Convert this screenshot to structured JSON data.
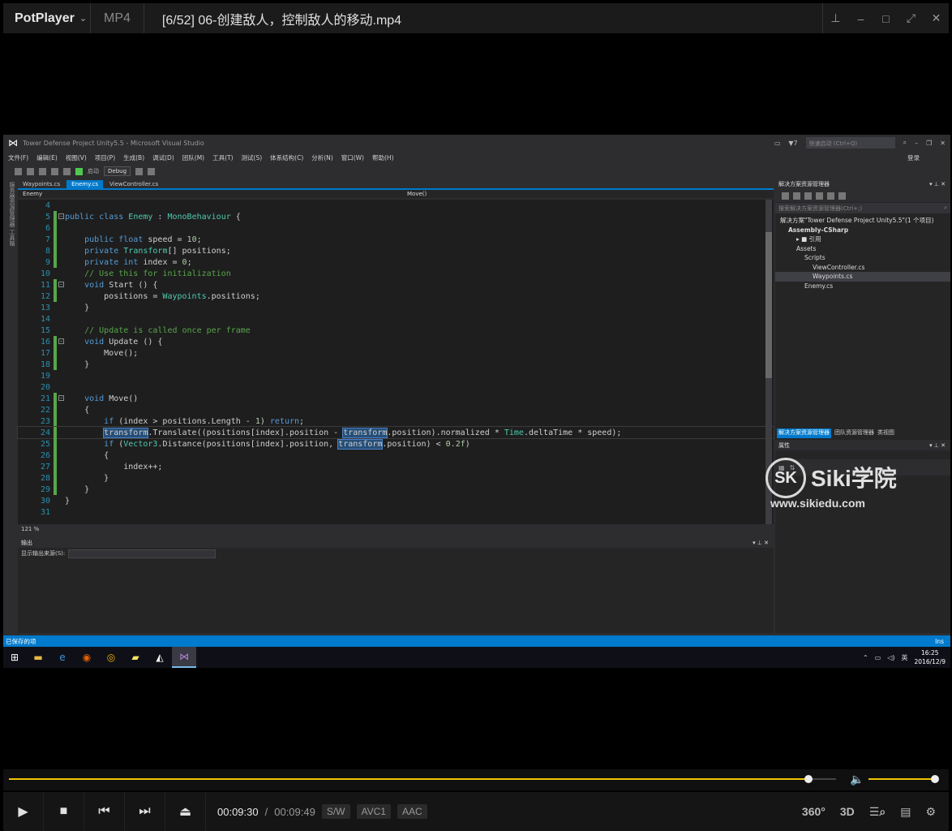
{
  "player": {
    "brand": "PotPlayer",
    "format": "MP4",
    "file_title": "[6/52] 06-创建敌人，控制敌人的移动.mp4",
    "time_current": "00:09:30",
    "time_sep": "/",
    "time_total": "00:09:49",
    "tag_sw": "S/W",
    "tag_video": "AVC1",
    "tag_audio": "AAC",
    "btn_360": "360°",
    "btn_3d": "3D",
    "progress_fraction": 0.967,
    "volume_fraction": 1.0,
    "accent_color": "#f2c200"
  },
  "vs": {
    "title": "Tower Defense Project Unity5.5 - Microsoft Visual Studio",
    "notif_count": "7",
    "quick_launch": "快速启动 (Ctrl+Q)",
    "menu": [
      "文件(F)",
      "编辑(E)",
      "视图(V)",
      "项目(P)",
      "生成(B)",
      "调试(D)",
      "团队(M)",
      "工具(T)",
      "测试(S)",
      "体系结构(C)",
      "分析(N)",
      "窗口(W)",
      "帮助(H)"
    ],
    "login": "登录",
    "toolbar_start": "启动",
    "toolbar_config": "Debug",
    "left_rail": "服务器资源管理器  工具箱",
    "tabs": [
      "Waypoints.cs",
      "Enemy.cs",
      "ViewController.cs"
    ],
    "nav_left": "Enemy",
    "nav_right": "Move()",
    "zoom": "121 %",
    "output_title": "输出",
    "output_source_label": "显示输出来源(S):",
    "sol_title": "解决方案资源管理器",
    "sol_search": "搜索解决方案资源管理器(Ctrl+;)",
    "sol_tree": [
      {
        "label": "解决方案\"Tower Defense Project Unity5.5\"(1 个项目)",
        "indent": 0
      },
      {
        "label": "Assembly-CSharp",
        "indent": 1
      },
      {
        "label": "▸ ■ 引用",
        "indent": 2
      },
      {
        "label": "Assets",
        "indent": 2
      },
      {
        "label": "Scripts",
        "indent": 3
      },
      {
        "label": "ViewController.cs",
        "indent": 4
      },
      {
        "label": "Waypoints.cs",
        "indent": 4
      },
      {
        "label": "Enemy.cs",
        "indent": 3
      }
    ],
    "sol_tabs": [
      "解决方案资源管理器",
      "团队资源管理器",
      "类视图"
    ],
    "props_title": "属性",
    "status_left": "已保存的项",
    "status_right": "Ins",
    "clock_time": "16:25",
    "clock_date": "2016/12/9",
    "tray_lang": "英"
  },
  "code": [
    {
      "n": "4",
      "text": ""
    },
    {
      "n": "5",
      "text": "public class Enemy : MonoBehaviour {"
    },
    {
      "n": "6",
      "text": ""
    },
    {
      "n": "7",
      "text": "    public float speed = 10;"
    },
    {
      "n": "8",
      "text": "    private Transform[] positions;"
    },
    {
      "n": "9",
      "text": "    private int index = 0;"
    },
    {
      "n": "10",
      "text": "    // Use this for initialization"
    },
    {
      "n": "11",
      "text": "    void Start () {"
    },
    {
      "n": "12",
      "text": "        positions = Waypoints.positions;"
    },
    {
      "n": "13",
      "text": "    }"
    },
    {
      "n": "14",
      "text": ""
    },
    {
      "n": "15",
      "text": "    // Update is called once per frame"
    },
    {
      "n": "16",
      "text": "    void Update () {"
    },
    {
      "n": "17",
      "text": "        Move();"
    },
    {
      "n": "18",
      "text": "    }"
    },
    {
      "n": "19",
      "text": ""
    },
    {
      "n": "20",
      "text": ""
    },
    {
      "n": "21",
      "text": "    void Move()"
    },
    {
      "n": "22",
      "text": "    {"
    },
    {
      "n": "23",
      "text": "        if (index > positions.Length - 1) return;"
    },
    {
      "n": "24",
      "text": "        transform.Translate((positions[index].position - transform.position).normalized * Time.deltaTime * speed);"
    },
    {
      "n": "25",
      "text": "        if (Vector3.Distance(positions[index].position, transform.position) < 0.2f)"
    },
    {
      "n": "26",
      "text": "        {"
    },
    {
      "n": "27",
      "text": "            index++;"
    },
    {
      "n": "28",
      "text": "        }"
    },
    {
      "n": "29",
      "text": "    }"
    },
    {
      "n": "30",
      "text": "}"
    },
    {
      "n": "31",
      "text": ""
    }
  ],
  "watermark": {
    "logo": "SK",
    "name": "Siki学院",
    "url": "www.sikiedu.com"
  }
}
